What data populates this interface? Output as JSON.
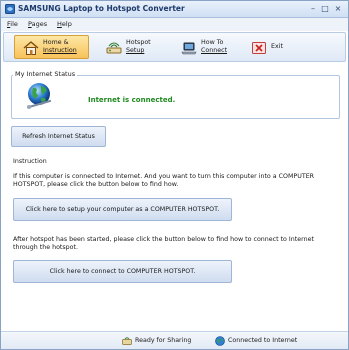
{
  "window": {
    "title": "SAMSUNG Laptop to Hotspot Converter",
    "controls": {
      "minimize": "–",
      "maximize": "□",
      "close": "×"
    }
  },
  "menu": {
    "file": {
      "key": "F",
      "rest": "ile"
    },
    "pages": {
      "key": "P",
      "rest": "ages"
    },
    "help": {
      "key": "H",
      "rest": "elp"
    }
  },
  "toolbar": {
    "home": {
      "line1": "Home &",
      "line2": "Instruction",
      "icon": "home-icon",
      "active": true
    },
    "hotspot": {
      "line1": "Hotspot",
      "line2": "Setup",
      "icon": "hotspot-setup-icon"
    },
    "howto": {
      "line1": "How To",
      "line2": "Connect",
      "icon": "laptop-connect-icon"
    },
    "exit": {
      "label": "Exit",
      "icon": "exit-icon"
    }
  },
  "internet_status": {
    "group_label": "My Internet Status",
    "message": "Internet is connected.",
    "icon": "globe-icon"
  },
  "refresh_button": "Refresh Internet Status",
  "instruction": {
    "heading": "Instruction",
    "para1": "If this computer is connected to Internet. And you want to turn this computer into a COMPUTER HOTSPOT, please click the button below to find how.",
    "setup_button": "Click here to setup your computer as a COMPUTER HOTSPOT.",
    "para2": "After hotspot has been started, please click the button below to find how to connect to Internet through the hotspot.",
    "connect_button": "Click here to connect to COMPUTER HOTSPOT."
  },
  "statusbar": {
    "sharing": "Ready for Sharing",
    "connected": "Connected to Internet"
  },
  "colors": {
    "accent": "#1f8a1f",
    "toolbar_active": "#f8c25a",
    "button_border": "#9fb6d6"
  }
}
